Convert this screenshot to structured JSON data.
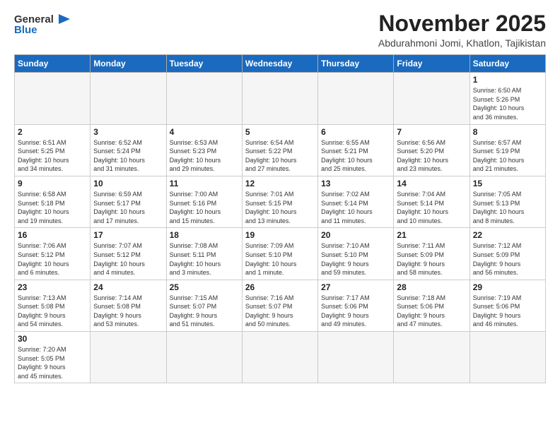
{
  "logo": {
    "text_general": "General",
    "text_blue": "Blue"
  },
  "header": {
    "month": "November 2025",
    "location": "Abdurahmoni Jomi, Khatlon, Tajikistan"
  },
  "weekdays": [
    "Sunday",
    "Monday",
    "Tuesday",
    "Wednesday",
    "Thursday",
    "Friday",
    "Saturday"
  ],
  "weeks": [
    [
      {
        "day": "",
        "info": ""
      },
      {
        "day": "",
        "info": ""
      },
      {
        "day": "",
        "info": ""
      },
      {
        "day": "",
        "info": ""
      },
      {
        "day": "",
        "info": ""
      },
      {
        "day": "",
        "info": ""
      },
      {
        "day": "1",
        "info": "Sunrise: 6:50 AM\nSunset: 5:26 PM\nDaylight: 10 hours\nand 36 minutes."
      }
    ],
    [
      {
        "day": "2",
        "info": "Sunrise: 6:51 AM\nSunset: 5:25 PM\nDaylight: 10 hours\nand 34 minutes."
      },
      {
        "day": "3",
        "info": "Sunrise: 6:52 AM\nSunset: 5:24 PM\nDaylight: 10 hours\nand 31 minutes."
      },
      {
        "day": "4",
        "info": "Sunrise: 6:53 AM\nSunset: 5:23 PM\nDaylight: 10 hours\nand 29 minutes."
      },
      {
        "day": "5",
        "info": "Sunrise: 6:54 AM\nSunset: 5:22 PM\nDaylight: 10 hours\nand 27 minutes."
      },
      {
        "day": "6",
        "info": "Sunrise: 6:55 AM\nSunset: 5:21 PM\nDaylight: 10 hours\nand 25 minutes."
      },
      {
        "day": "7",
        "info": "Sunrise: 6:56 AM\nSunset: 5:20 PM\nDaylight: 10 hours\nand 23 minutes."
      },
      {
        "day": "8",
        "info": "Sunrise: 6:57 AM\nSunset: 5:19 PM\nDaylight: 10 hours\nand 21 minutes."
      }
    ],
    [
      {
        "day": "9",
        "info": "Sunrise: 6:58 AM\nSunset: 5:18 PM\nDaylight: 10 hours\nand 19 minutes."
      },
      {
        "day": "10",
        "info": "Sunrise: 6:59 AM\nSunset: 5:17 PM\nDaylight: 10 hours\nand 17 minutes."
      },
      {
        "day": "11",
        "info": "Sunrise: 7:00 AM\nSunset: 5:16 PM\nDaylight: 10 hours\nand 15 minutes."
      },
      {
        "day": "12",
        "info": "Sunrise: 7:01 AM\nSunset: 5:15 PM\nDaylight: 10 hours\nand 13 minutes."
      },
      {
        "day": "13",
        "info": "Sunrise: 7:02 AM\nSunset: 5:14 PM\nDaylight: 10 hours\nand 11 minutes."
      },
      {
        "day": "14",
        "info": "Sunrise: 7:04 AM\nSunset: 5:14 PM\nDaylight: 10 hours\nand 10 minutes."
      },
      {
        "day": "15",
        "info": "Sunrise: 7:05 AM\nSunset: 5:13 PM\nDaylight: 10 hours\nand 8 minutes."
      }
    ],
    [
      {
        "day": "16",
        "info": "Sunrise: 7:06 AM\nSunset: 5:12 PM\nDaylight: 10 hours\nand 6 minutes."
      },
      {
        "day": "17",
        "info": "Sunrise: 7:07 AM\nSunset: 5:12 PM\nDaylight: 10 hours\nand 4 minutes."
      },
      {
        "day": "18",
        "info": "Sunrise: 7:08 AM\nSunset: 5:11 PM\nDaylight: 10 hours\nand 3 minutes."
      },
      {
        "day": "19",
        "info": "Sunrise: 7:09 AM\nSunset: 5:10 PM\nDaylight: 10 hours\nand 1 minute."
      },
      {
        "day": "20",
        "info": "Sunrise: 7:10 AM\nSunset: 5:10 PM\nDaylight: 9 hours\nand 59 minutes."
      },
      {
        "day": "21",
        "info": "Sunrise: 7:11 AM\nSunset: 5:09 PM\nDaylight: 9 hours\nand 58 minutes."
      },
      {
        "day": "22",
        "info": "Sunrise: 7:12 AM\nSunset: 5:09 PM\nDaylight: 9 hours\nand 56 minutes."
      }
    ],
    [
      {
        "day": "23",
        "info": "Sunrise: 7:13 AM\nSunset: 5:08 PM\nDaylight: 9 hours\nand 54 minutes."
      },
      {
        "day": "24",
        "info": "Sunrise: 7:14 AM\nSunset: 5:08 PM\nDaylight: 9 hours\nand 53 minutes."
      },
      {
        "day": "25",
        "info": "Sunrise: 7:15 AM\nSunset: 5:07 PM\nDaylight: 9 hours\nand 51 minutes."
      },
      {
        "day": "26",
        "info": "Sunrise: 7:16 AM\nSunset: 5:07 PM\nDaylight: 9 hours\nand 50 minutes."
      },
      {
        "day": "27",
        "info": "Sunrise: 7:17 AM\nSunset: 5:06 PM\nDaylight: 9 hours\nand 49 minutes."
      },
      {
        "day": "28",
        "info": "Sunrise: 7:18 AM\nSunset: 5:06 PM\nDaylight: 9 hours\nand 47 minutes."
      },
      {
        "day": "29",
        "info": "Sunrise: 7:19 AM\nSunset: 5:06 PM\nDaylight: 9 hours\nand 46 minutes."
      }
    ],
    [
      {
        "day": "30",
        "info": "Sunrise: 7:20 AM\nSunset: 5:05 PM\nDaylight: 9 hours\nand 45 minutes."
      },
      {
        "day": "",
        "info": ""
      },
      {
        "day": "",
        "info": ""
      },
      {
        "day": "",
        "info": ""
      },
      {
        "day": "",
        "info": ""
      },
      {
        "day": "",
        "info": ""
      },
      {
        "day": "",
        "info": ""
      }
    ]
  ]
}
